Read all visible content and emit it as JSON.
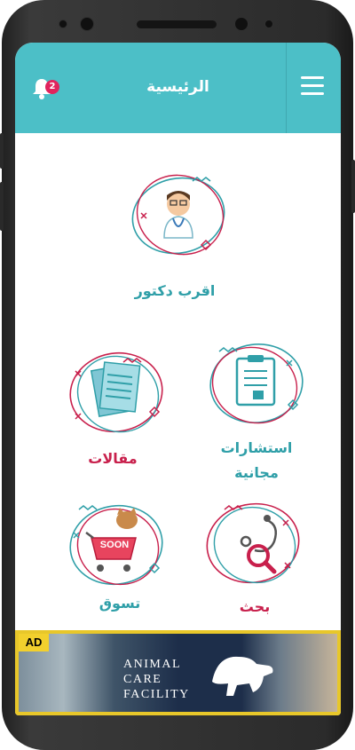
{
  "header": {
    "title": "الرئيسية",
    "notification_count": "2"
  },
  "tiles": {
    "doctor": {
      "label": "اقرب دكتور"
    },
    "consultations": {
      "label_line1": "استشارات",
      "label_line2": "مجانية"
    },
    "articles": {
      "label": "مقالات"
    },
    "search": {
      "label": "بحث"
    },
    "shop": {
      "label": "تسوق",
      "sign_text": "SOON"
    }
  },
  "ad": {
    "tag": "AD",
    "line1": "ANIMAL",
    "line2": "CARE",
    "line3": "FACILITY"
  },
  "colors": {
    "header": "#4cbfc7",
    "teal": "#2f9fa8",
    "red": "#c8204c",
    "ad_border": "#e8c72a"
  }
}
